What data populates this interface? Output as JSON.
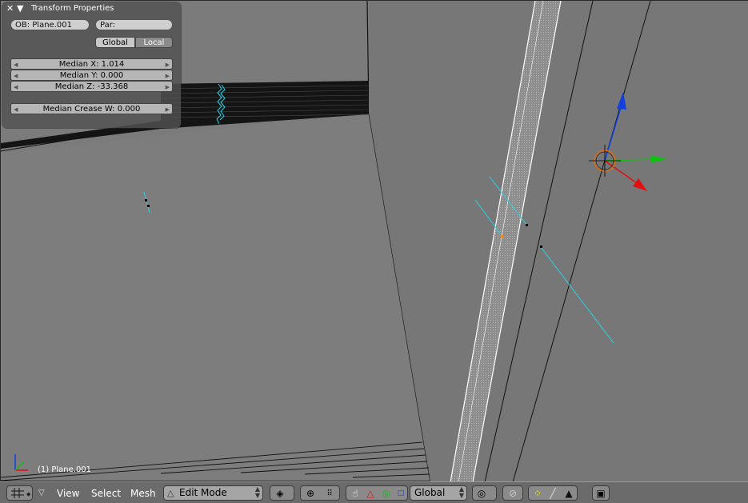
{
  "panel": {
    "title": "Transform Properties",
    "close_icon": "close-icon",
    "collapse_icon": "triangle-down-icon",
    "object_field": "OB: Plane.001",
    "parent_field": "Par:",
    "space_global": "Global",
    "space_local": "Local",
    "median_x": "Median X: 1.014",
    "median_y": "Median Y: 0.000",
    "median_z": "Median Z: -33.368",
    "median_crease": "Median Crease W: 0.000"
  },
  "viewport": {
    "object_label": "(1) Plane.001"
  },
  "header": {
    "menus": [
      "View",
      "Select",
      "Mesh"
    ],
    "mode": "Edit Mode",
    "orientation": "Global"
  },
  "colors": {
    "viewport_bg": "#7d7d7d",
    "gizmo_x": "#e01010",
    "gizmo_y": "#10c010",
    "gizmo_z": "#1040e0",
    "edge_highlight": "#29d3e6"
  }
}
